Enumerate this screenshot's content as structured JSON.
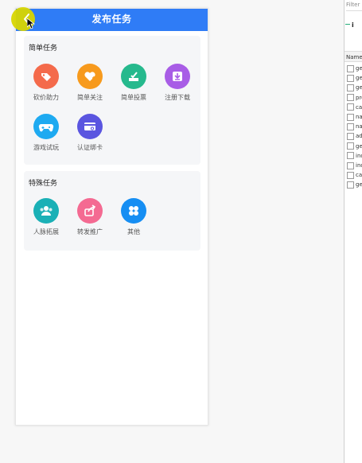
{
  "header": {
    "title": "发布任务"
  },
  "sections": [
    {
      "title": "简单任务",
      "items": [
        {
          "label": "砍价助力",
          "icon": "coupon-icon",
          "color": "#f46a4b"
        },
        {
          "label": "简单关注",
          "icon": "heart-plus-icon",
          "color": "#f79a1d"
        },
        {
          "label": "简单投票",
          "icon": "vote-icon",
          "color": "#26b98d"
        },
        {
          "label": "注册下载",
          "icon": "download-icon",
          "color": "#a85de6"
        },
        {
          "label": "游戏试玩",
          "icon": "gamepad-icon",
          "color": "#1eaaf1"
        },
        {
          "label": "认证绑卡",
          "icon": "card-link-icon",
          "color": "#5a55e0"
        }
      ]
    },
    {
      "title": "特殊任务",
      "items": [
        {
          "label": "人脉拓展",
          "icon": "people-icon",
          "color": "#1ab0b6"
        },
        {
          "label": "转发推广",
          "icon": "share-icon",
          "color": "#f46a92"
        },
        {
          "label": "其他",
          "icon": "grid-icon",
          "color": "#168ef3"
        }
      ]
    }
  ],
  "devtools": {
    "filter_label": "Filter",
    "info_glyph": "i",
    "name_header": "Name",
    "files": [
      "ge",
      "ge",
      "ge",
      "pro",
      "cat",
      "nav",
      "nav",
      "adj",
      "ge",
      "ind",
      "ind",
      "cat",
      "ge"
    ]
  }
}
